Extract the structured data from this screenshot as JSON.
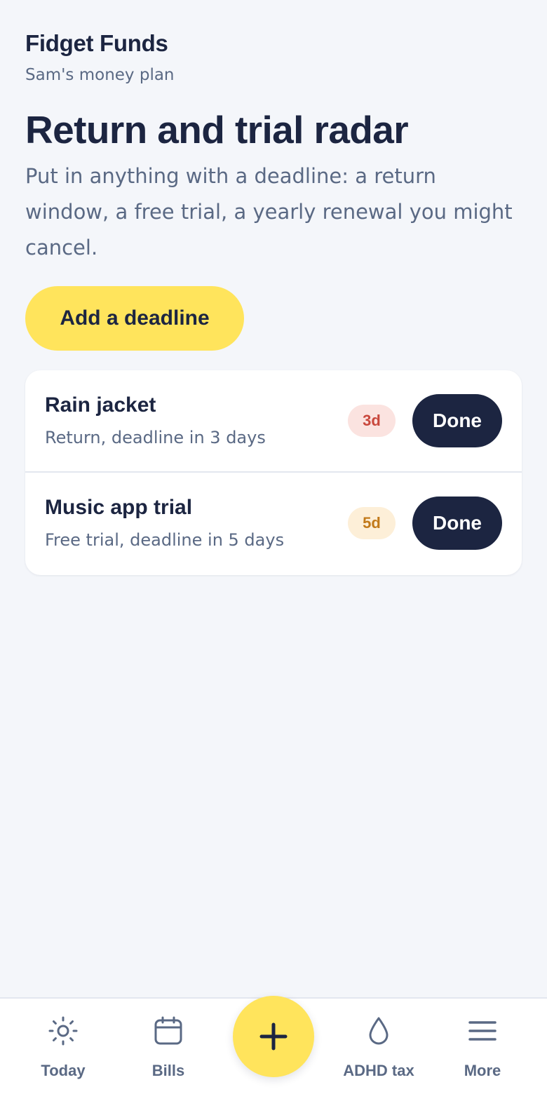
{
  "app": {
    "title": "Fidget Funds",
    "subtitle": "Sam's money plan"
  },
  "page": {
    "title": "Return and trial radar",
    "description": "Put in anything with a deadline: a return window, a free trial, a yearly renewal you might cancel.",
    "add_button": "Add a deadline"
  },
  "deadlines": [
    {
      "title": "Rain jacket",
      "detail": "Return, deadline in 3 days",
      "badge": "3d",
      "badge_color": "#c9483d",
      "action": "Done"
    },
    {
      "title": "Music app trial",
      "detail": "Free trial, deadline in 5 days",
      "badge": "5d",
      "badge_color": "#c27a1a",
      "action": "Done"
    }
  ],
  "nav": {
    "items": [
      {
        "label": "Today",
        "icon": "sun-icon"
      },
      {
        "label": "Bills",
        "icon": "calendar-icon"
      },
      {
        "label": "ADHD tax",
        "icon": "drop-icon"
      },
      {
        "label": "More",
        "icon": "menu-icon"
      }
    ],
    "fab_icon": "plus-icon"
  },
  "colors": {
    "accent": "#ffe45c",
    "navy": "#1c2541",
    "background": "#f4f6fa",
    "muted_text": "#5a6984"
  }
}
